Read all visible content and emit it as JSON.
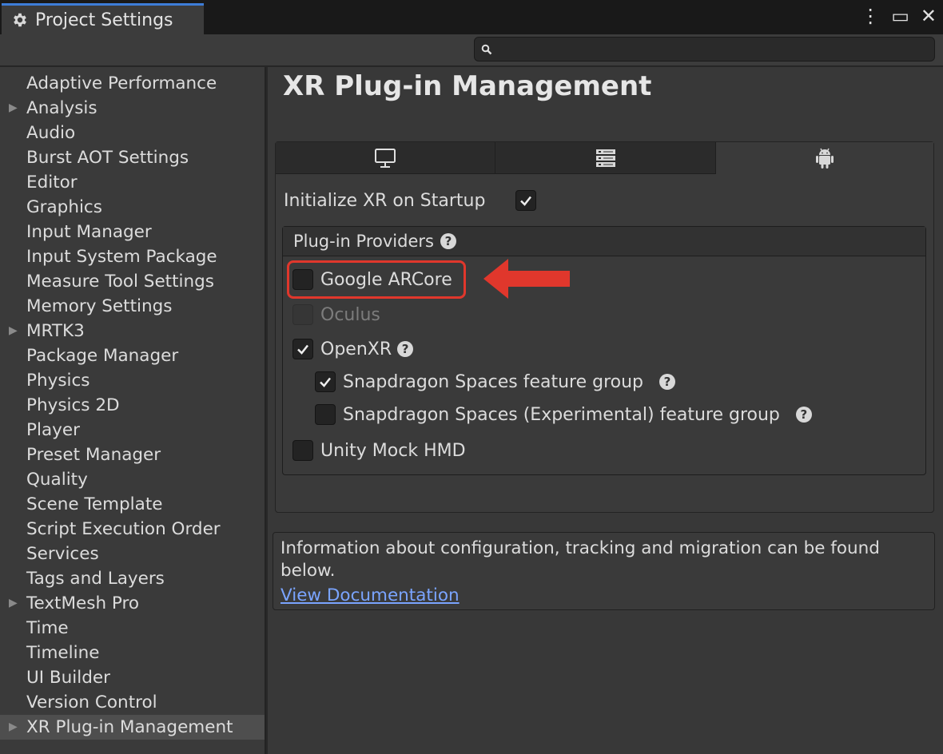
{
  "window": {
    "title": "Project Settings",
    "controls": [
      "⋮",
      "▭",
      "✕"
    ]
  },
  "search": {
    "placeholder": "",
    "value": ""
  },
  "sidebar": {
    "items": [
      {
        "label": "Adaptive Performance",
        "expandable": false
      },
      {
        "label": "Analysis",
        "expandable": true
      },
      {
        "label": "Audio",
        "expandable": false
      },
      {
        "label": "Burst AOT Settings",
        "expandable": false
      },
      {
        "label": "Editor",
        "expandable": false
      },
      {
        "label": "Graphics",
        "expandable": false
      },
      {
        "label": "Input Manager",
        "expandable": false
      },
      {
        "label": "Input System Package",
        "expandable": false
      },
      {
        "label": "Measure Tool Settings",
        "expandable": false
      },
      {
        "label": "Memory Settings",
        "expandable": false
      },
      {
        "label": "MRTK3",
        "expandable": true
      },
      {
        "label": "Package Manager",
        "expandable": false
      },
      {
        "label": "Physics",
        "expandable": false
      },
      {
        "label": "Physics 2D",
        "expandable": false
      },
      {
        "label": "Player",
        "expandable": false
      },
      {
        "label": "Preset Manager",
        "expandable": false
      },
      {
        "label": "Quality",
        "expandable": false
      },
      {
        "label": "Scene Template",
        "expandable": false
      },
      {
        "label": "Script Execution Order",
        "expandable": false
      },
      {
        "label": "Services",
        "expandable": false
      },
      {
        "label": "Tags and Layers",
        "expandable": false
      },
      {
        "label": "TextMesh Pro",
        "expandable": true
      },
      {
        "label": "Time",
        "expandable": false
      },
      {
        "label": "Timeline",
        "expandable": false
      },
      {
        "label": "UI Builder",
        "expandable": false
      },
      {
        "label": "Version Control",
        "expandable": false
      },
      {
        "label": "XR Plug-in Management",
        "expandable": true,
        "selected": true
      }
    ]
  },
  "main": {
    "title": "XR Plug-in Management",
    "platform_tabs": [
      {
        "icon": "desktop-icon",
        "active": false
      },
      {
        "icon": "server-icon",
        "active": false
      },
      {
        "icon": "android-icon",
        "active": true
      }
    ],
    "initialize_label": "Initialize XR on Startup",
    "initialize_checked": true,
    "providers_title": "Plug-in Providers",
    "providers": [
      {
        "label": "Google ARCore",
        "checked": false,
        "enabled": true,
        "highlighted": true
      },
      {
        "label": "Oculus",
        "checked": false,
        "enabled": false
      },
      {
        "label": "OpenXR",
        "checked": true,
        "enabled": true,
        "help": true
      },
      {
        "label": "Snapdragon Spaces feature group",
        "checked": true,
        "enabled": true,
        "help": true,
        "indent": true
      },
      {
        "label": "Snapdragon Spaces (Experimental) feature group",
        "checked": false,
        "enabled": true,
        "help": true,
        "indent": true
      },
      {
        "label": "Unity Mock HMD",
        "checked": false,
        "enabled": true
      }
    ],
    "info_text": "Information about configuration, tracking and migration can be found below.",
    "info_link": "View Documentation"
  },
  "colors": {
    "accent_tab": "#3d7dd8",
    "highlight": "#e0372c",
    "link": "#7aa4ff",
    "background": "#383838",
    "sidebar": "#3a3a3a"
  }
}
